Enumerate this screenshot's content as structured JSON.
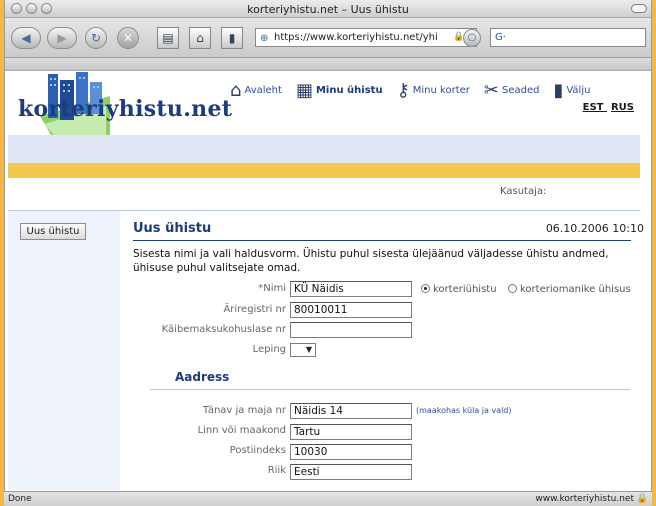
{
  "window": {
    "title": "korteriyhistu.net – Uus ühistu",
    "url": "https://www.korteriyhistu.net/yhi",
    "search_value": "G·"
  },
  "site": {
    "logo": "korteriyhistu.net",
    "nav": [
      {
        "label": "Avaleht",
        "icon": "house-icon"
      },
      {
        "label": "Minu ühistu",
        "icon": "apartment-icon"
      },
      {
        "label": "Minu korter",
        "icon": "keys-icon"
      },
      {
        "label": "Seaded",
        "icon": "tools-icon"
      },
      {
        "label": "Välju",
        "icon": "exit-icon"
      }
    ],
    "lang_est": "EST",
    "lang_rus": "RUS",
    "user_label": "Kasutaja:"
  },
  "sidebar": {
    "button": "Uus ühistu"
  },
  "main": {
    "title": "Uus ühistu",
    "date": "06.10.2006 10:10",
    "intro": "Sisesta nimi ja vali haldusvorm. Ühistu puhul sisesta ülejäänud väljadesse ühistu andmed, ühisuse puhul valitsejate omad.",
    "name_label": "*Nimi",
    "name_value": "KÜ Näidis",
    "radio1": "korteriühistu",
    "radio2": "korteriomanike ühisus",
    "reg_label": "Äriregistri nr",
    "reg_value": "80010011",
    "vat_label": "Käibemaksukohuslase nr",
    "vat_value": "",
    "contract_label": "Leping",
    "address_title": "Aadress",
    "street_label": "Tänav ja maja nr",
    "street_value": "Näidis 14",
    "street_hint": "(maakohas küla ja vald)",
    "city_label": "Linn või maakond",
    "city_value": "Tartu",
    "zip_label": "Postiindeks",
    "zip_value": "10030",
    "country_label": "Riik",
    "country_value": "Eesti"
  },
  "status": {
    "left": "Done",
    "right": "www.korteriyhistu.net"
  }
}
